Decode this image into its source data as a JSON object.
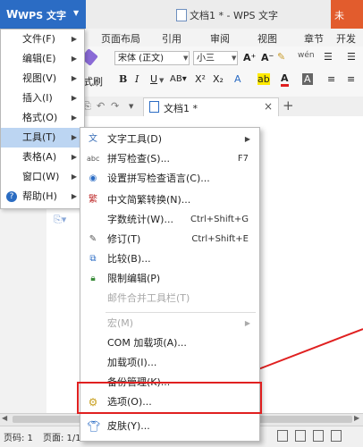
{
  "titlebar": {
    "app_logo": "W",
    "app_name": "WPS 文字",
    "window_title": "文档1 * - WPS 文字",
    "red_button": "未"
  },
  "ribbon_tabs": [
    "页面布局",
    "引用",
    "审阅",
    "视图",
    "章节",
    "开发"
  ],
  "toolbar": {
    "font_name": "宋体 (正文)",
    "font_size": "小三",
    "format_painter": "式刷",
    "bold": "B",
    "italic": "I",
    "underline": "U"
  },
  "doc_tab": {
    "title": "文档1 *",
    "close": "×",
    "add": "+"
  },
  "main_menu": [
    {
      "label": "文件(F)"
    },
    {
      "label": "编辑(E)"
    },
    {
      "label": "视图(V)"
    },
    {
      "label": "插入(I)"
    },
    {
      "label": "格式(O)"
    },
    {
      "label": "工具(T)"
    },
    {
      "label": "表格(A)"
    },
    {
      "label": "窗口(W)"
    },
    {
      "label": "帮助(H)"
    }
  ],
  "tools_submenu": {
    "text_tools": "文字工具(D)",
    "spell_check": "拼写检查(S)...",
    "spell_check_shortcut": "F7",
    "spell_language": "设置拼写检查语言(C)...",
    "chinese_convert": "中文简繁转换(N)...",
    "word_count": "字数统计(W)...",
    "word_count_shortcut": "Ctrl+Shift+G",
    "track_changes": "修订(T)",
    "track_changes_shortcut": "Ctrl+Shift+E",
    "compare": "比较(B)...",
    "restrict_edit": "限制编辑(P)",
    "mail_merge": "邮件合并工具栏(T)",
    "macro": "宏(M)",
    "com_addins": "COM 加载项(A)...",
    "addins": "加载项(I)...",
    "backup": "备份管理(K)...",
    "options": "选项(O)...",
    "skin": "皮肤(Y)..."
  },
  "status": {
    "page_no": "页码: 1",
    "pages": "页面: 1/1"
  },
  "colors": {
    "app_blue": "#2b6cc4",
    "menu_highlight": "#bcd5f2",
    "annotation_red": "#e02020"
  }
}
